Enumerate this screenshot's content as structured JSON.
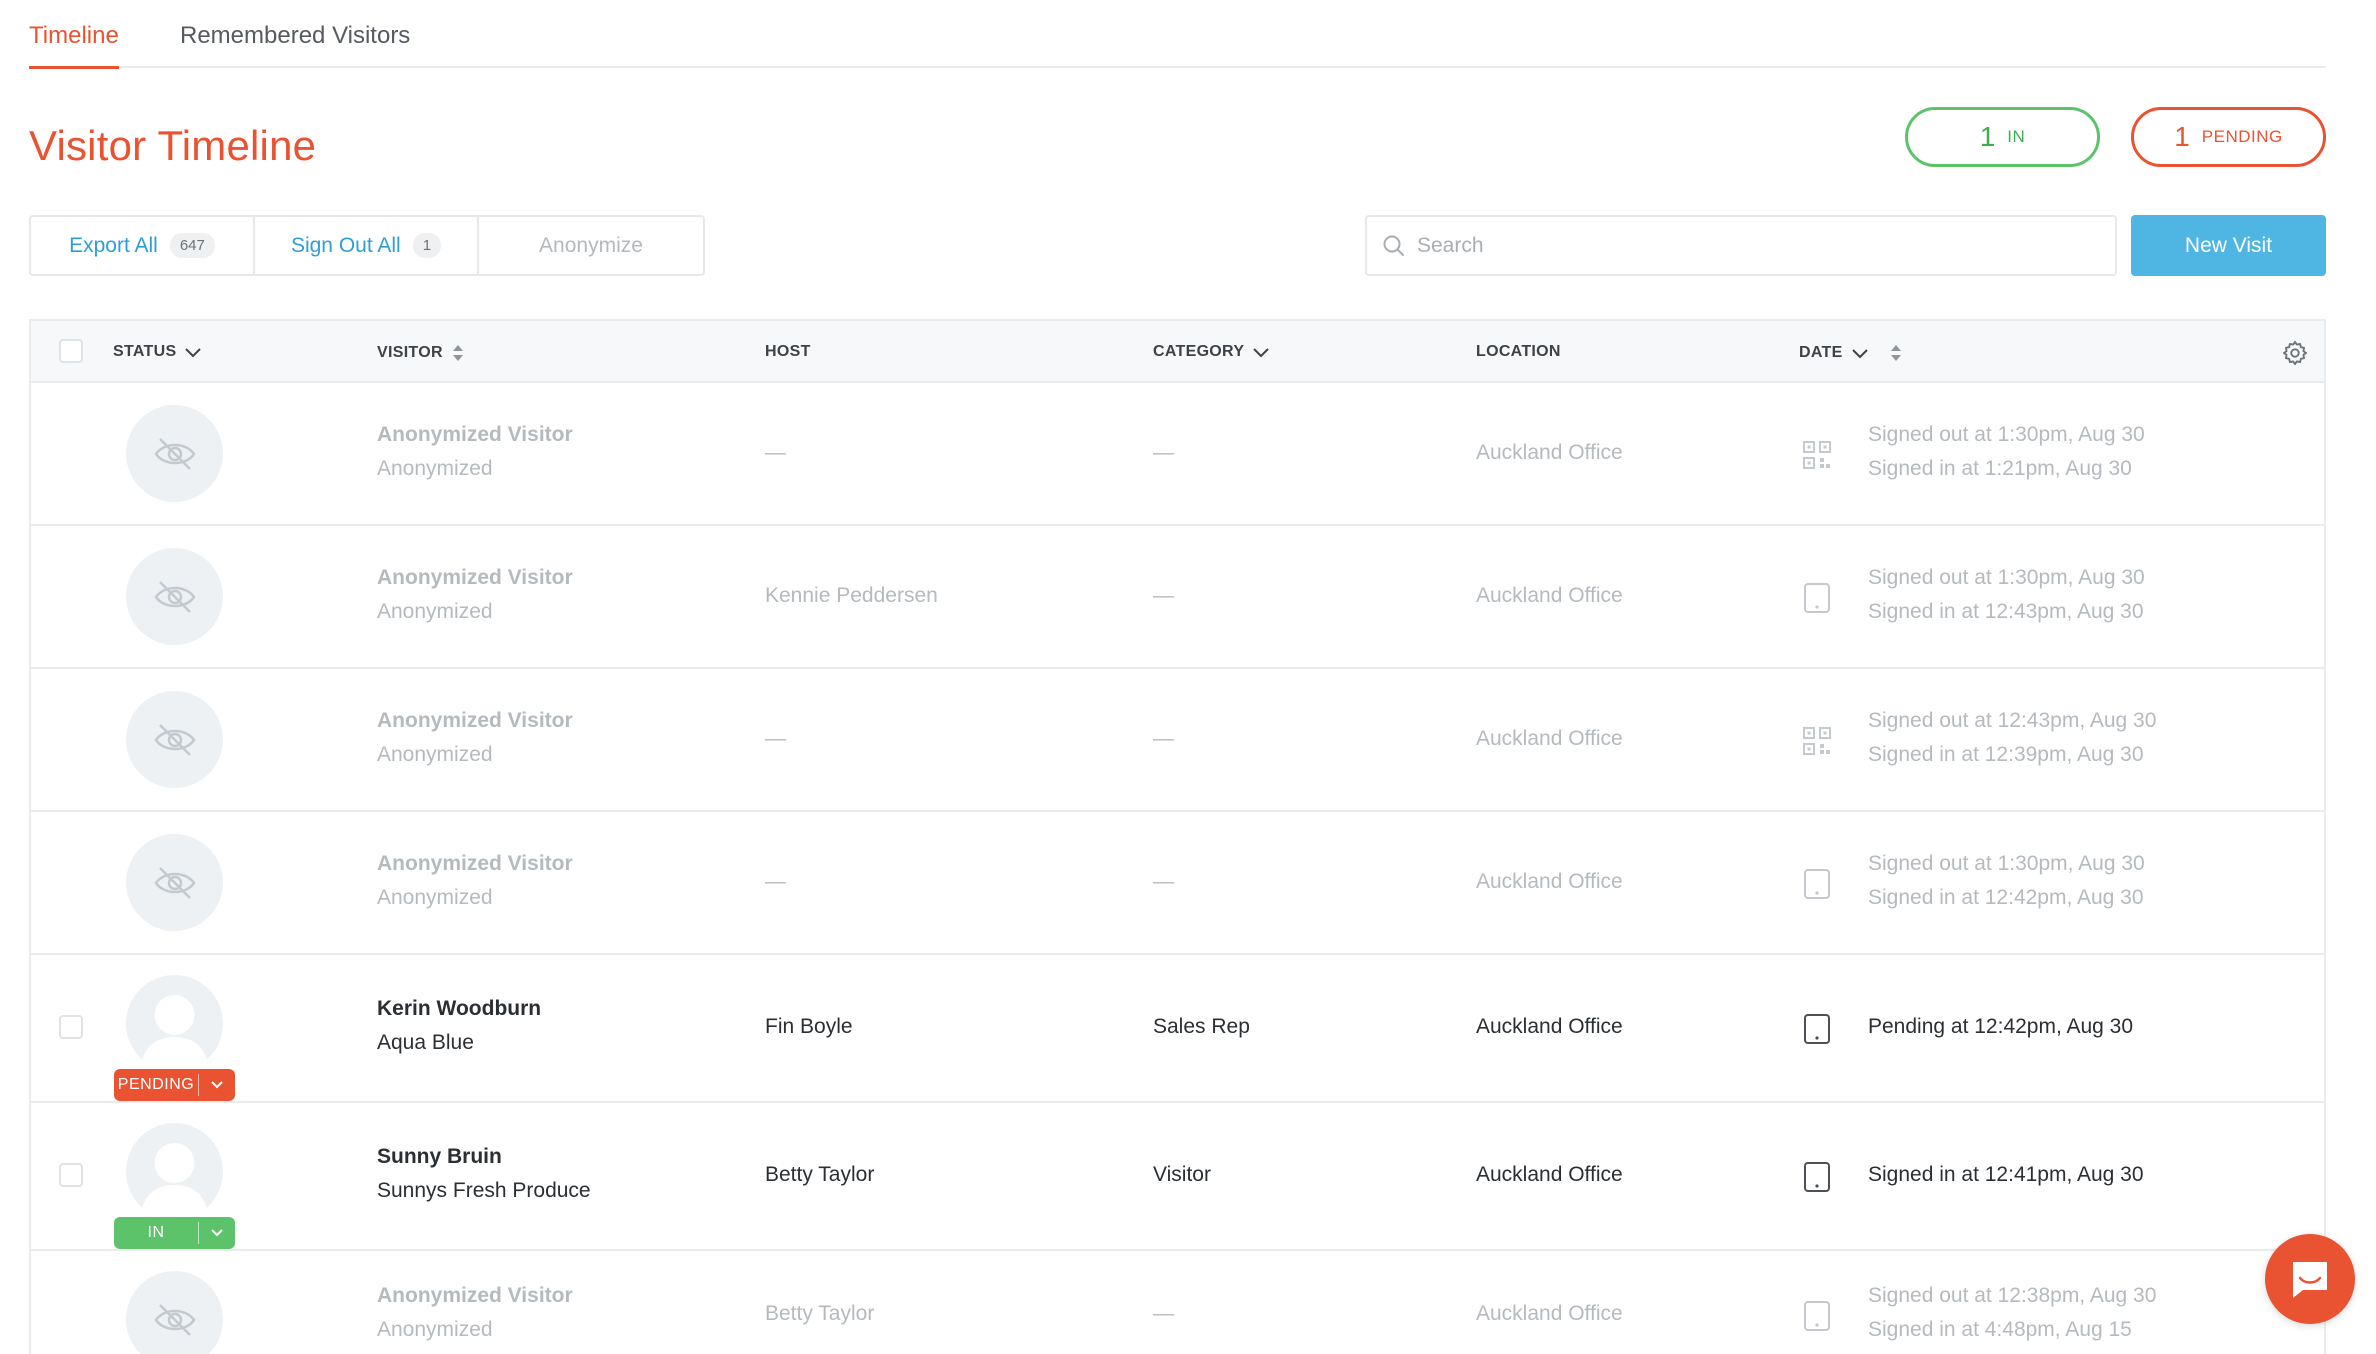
{
  "tabs": [
    {
      "label": "Timeline",
      "active": true
    },
    {
      "label": "Remembered Visitors",
      "active": false
    }
  ],
  "page_title": "Visitor Timeline",
  "summary": {
    "in": {
      "count": "1",
      "label": "IN"
    },
    "pending": {
      "count": "1",
      "label": "PENDING"
    }
  },
  "actions": {
    "export_label": "Export All",
    "export_count": "647",
    "signout_label": "Sign Out All",
    "signout_count": "1",
    "anonymize_label": "Anonymize"
  },
  "search": {
    "placeholder": "Search"
  },
  "new_visit_label": "New Visit",
  "columns": {
    "status": "STATUS",
    "visitor": "VISITOR",
    "host": "HOST",
    "category": "CATEGORY",
    "location": "LOCATION",
    "date": "DATE"
  },
  "rows": [
    {
      "name": "Anonymized Visitor",
      "company": "Anonymized",
      "host": "—",
      "category": "—",
      "location": "Auckland Office",
      "device": "qr-code-icon",
      "date_line1": "Signed out at 1:30pm, Aug 30",
      "date_line2": "Signed in at 1:21pm, Aug 30",
      "anonymized": true
    },
    {
      "name": "Anonymized Visitor",
      "company": "Anonymized",
      "host": "Kennie Peddersen",
      "category": "—",
      "location": "Auckland Office",
      "device": "tablet-icon",
      "date_line1": "Signed out at 1:30pm, Aug 30",
      "date_line2": "Signed in at 12:43pm, Aug 30",
      "anonymized": true
    },
    {
      "name": "Anonymized Visitor",
      "company": "Anonymized",
      "host": "—",
      "category": "—",
      "location": "Auckland Office",
      "device": "qr-code-icon",
      "date_line1": "Signed out at 12:43pm, Aug 30",
      "date_line2": "Signed in at 12:39pm, Aug 30",
      "anonymized": true
    },
    {
      "name": "Anonymized Visitor",
      "company": "Anonymized",
      "host": "—",
      "category": "—",
      "location": "Auckland Office",
      "device": "tablet-icon",
      "date_line1": "Signed out at 1:30pm, Aug 30",
      "date_line2": "Signed in at 12:42pm, Aug 30",
      "anonymized": true
    },
    {
      "name": "Kerin Woodburn",
      "company": "Aqua Blue",
      "host": "Fin Boyle",
      "category": "Sales Rep",
      "location": "Auckland Office",
      "device": "tablet-icon",
      "date_line1": "Pending at 12:42pm, Aug 30",
      "date_line2": "",
      "status": "PENDING",
      "anonymized": false
    },
    {
      "name": "Sunny Bruin",
      "company": "Sunnys Fresh Produce",
      "host": "Betty Taylor",
      "category": "Visitor",
      "location": "Auckland Office",
      "device": "tablet-icon",
      "date_line1": "Signed in at 12:41pm, Aug 30",
      "date_line2": "",
      "status": "IN",
      "anonymized": false
    },
    {
      "name": "Anonymized Visitor",
      "company": "Anonymized",
      "host": "Betty Taylor",
      "category": "—",
      "location": "Auckland Office",
      "device": "tablet-icon",
      "date_line1": "Signed out at 12:38pm, Aug 30",
      "date_line2": "Signed in at 4:48pm, Aug 15",
      "anonymized": true
    }
  ],
  "colors": {
    "accent": "#ea5331",
    "in_green": "#5cc36b",
    "link_blue": "#2e9fd6",
    "primary_button": "#4fb6e4"
  }
}
